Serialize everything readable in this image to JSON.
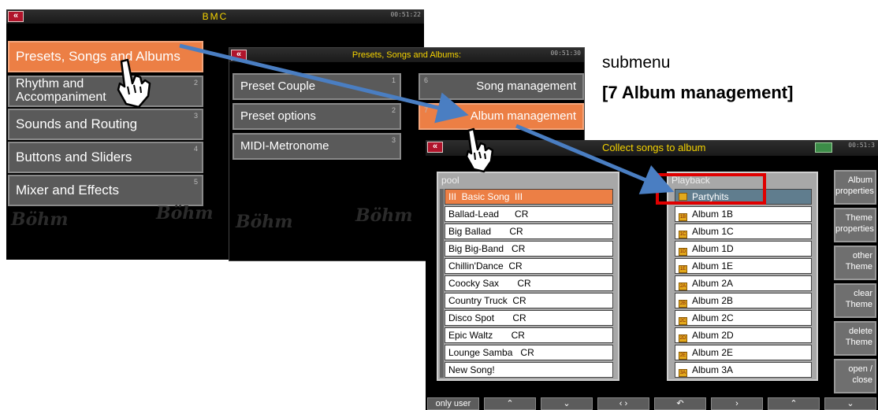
{
  "window1": {
    "back_label": "«",
    "title": "BMC",
    "clock": "00:51:22",
    "menu": [
      {
        "label": "Presets, Songs and Albums",
        "num": "",
        "active": true
      },
      {
        "label": "Rhythm and Accompaniment",
        "num": "2"
      },
      {
        "label": "Sounds and Routing",
        "num": "3"
      },
      {
        "label": "Buttons and Sliders",
        "num": "4"
      },
      {
        "label": "Mixer and Effects",
        "num": "5"
      }
    ],
    "watermark": "Böhm"
  },
  "window2": {
    "back_label": "«",
    "title": "Presets, Songs and Albums:",
    "clock": "00:51:30",
    "left_menu": [
      {
        "label": "Preset Couple",
        "num": "1"
      },
      {
        "label": "Preset options",
        "num": "2"
      },
      {
        "label": "MIDI-Metronome",
        "num": "3"
      }
    ],
    "right_menu": [
      {
        "label": "Song management",
        "num": "6"
      },
      {
        "label": "Album management",
        "num": "7",
        "active": true
      }
    ],
    "watermark": "Böhm"
  },
  "annotation": {
    "line1": "submenu",
    "line2": "[7 Album management]"
  },
  "window3": {
    "back_label": "«",
    "title": "Collect songs to album",
    "clock": "00:51:3",
    "pool": {
      "header": "pool",
      "items": [
        "III  Basic Song  III",
        "Ballad-Lead      CR",
        "Big Ballad       CR",
        "Big Big-Band   CR",
        "Chillin'Dance  CR",
        "Coocky Sax       CR",
        "Country Truck  CR",
        "Disco Spot       CR",
        "Epic Waltz       CR",
        "Lounge Samba   CR",
        "New Song!"
      ]
    },
    "playback": {
      "header": "Playback",
      "items": [
        {
          "label": "Partyhits",
          "icon": ""
        },
        {
          "label": "Album 1B",
          "icon": "1B"
        },
        {
          "label": "Album 1C",
          "icon": "1C"
        },
        {
          "label": "Album 1D",
          "icon": "1D"
        },
        {
          "label": "Album 1E",
          "icon": "1E"
        },
        {
          "label": "Album 2A",
          "icon": "2A"
        },
        {
          "label": "Album 2B",
          "icon": "2B"
        },
        {
          "label": "Album 2C",
          "icon": "2C"
        },
        {
          "label": "Album 2D",
          "icon": "2D"
        },
        {
          "label": "Album 2E",
          "icon": "2E"
        },
        {
          "label": "Album 3A",
          "icon": "3A"
        }
      ]
    },
    "side_buttons": [
      {
        "line1": "Album",
        "line2": "properties"
      },
      {
        "line1": "Theme",
        "line2": "properties"
      },
      {
        "line1": "other",
        "line2": "Theme"
      },
      {
        "line1": "clear",
        "line2": "Theme"
      },
      {
        "line1": "delete",
        "line2": "Theme"
      },
      {
        "line1": "open  /",
        "line2": "close"
      }
    ],
    "bottom_buttons": [
      "only user",
      "⌃",
      "⌄",
      "‹ ›",
      "↶",
      "›",
      "⌃",
      "⌄"
    ],
    "highlight_color": "#e00000"
  },
  "colors": {
    "accent_orange": "#ec7f45",
    "title_yellow": "#f5d300",
    "arrow_blue": "#4a7ec2"
  }
}
